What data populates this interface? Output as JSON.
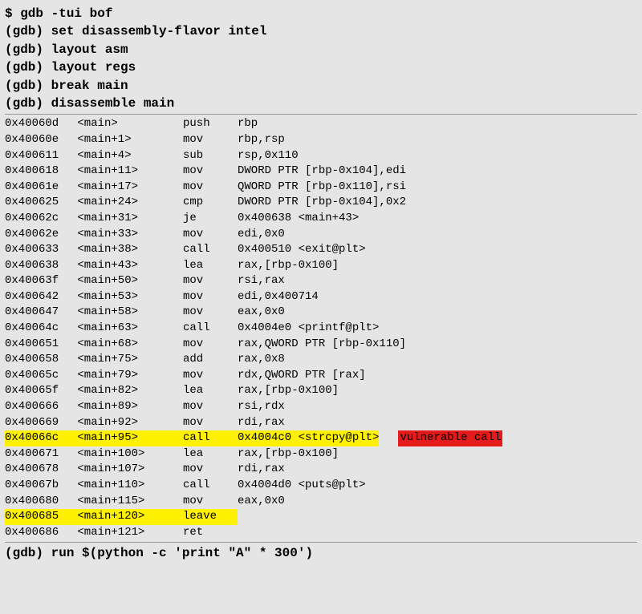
{
  "setup_lines": [
    "$ gdb -tui bof",
    "(gdb) set disassembly-flavor intel",
    "(gdb) layout asm",
    "(gdb) layout regs",
    "(gdb) break main",
    "(gdb) disassemble main"
  ],
  "asm": [
    {
      "addr": "0x40060d",
      "sym": "<main>",
      "op": "push",
      "ops": "rbp"
    },
    {
      "addr": "0x40060e",
      "sym": "<main+1>",
      "op": "mov",
      "ops": "rbp,rsp"
    },
    {
      "addr": "0x400611",
      "sym": "<main+4>",
      "op": "sub",
      "ops": "rsp,0x110"
    },
    {
      "addr": "0x400618",
      "sym": "<main+11>",
      "op": "mov",
      "ops": "DWORD PTR [rbp-0x104],edi"
    },
    {
      "addr": "0x40061e",
      "sym": "<main+17>",
      "op": "mov",
      "ops": "QWORD PTR [rbp-0x110],rsi"
    },
    {
      "addr": "0x400625",
      "sym": "<main+24>",
      "op": "cmp",
      "ops": "DWORD PTR [rbp-0x104],0x2"
    },
    {
      "addr": "0x40062c",
      "sym": "<main+31>",
      "op": "je",
      "ops": "0x400638 <main+43>"
    },
    {
      "addr": "0x40062e",
      "sym": "<main+33>",
      "op": "mov",
      "ops": "edi,0x0"
    },
    {
      "addr": "0x400633",
      "sym": "<main+38>",
      "op": "call",
      "ops": "0x400510 <exit@plt>"
    },
    {
      "addr": "0x400638",
      "sym": "<main+43>",
      "op": "lea",
      "ops": "rax,[rbp-0x100]"
    },
    {
      "addr": "0x40063f",
      "sym": "<main+50>",
      "op": "mov",
      "ops": "rsi,rax"
    },
    {
      "addr": "0x400642",
      "sym": "<main+53>",
      "op": "mov",
      "ops": "edi,0x400714"
    },
    {
      "addr": "0x400647",
      "sym": "<main+58>",
      "op": "mov",
      "ops": "eax,0x0"
    },
    {
      "addr": "0x40064c",
      "sym": "<main+63>",
      "op": "call",
      "ops": "0x4004e0 <printf@plt>"
    },
    {
      "addr": "0x400651",
      "sym": "<main+68>",
      "op": "mov",
      "ops": "rax,QWORD PTR [rbp-0x110]"
    },
    {
      "addr": "0x400658",
      "sym": "<main+75>",
      "op": "add",
      "ops": "rax,0x8"
    },
    {
      "addr": "0x40065c",
      "sym": "<main+79>",
      "op": "mov",
      "ops": "rdx,QWORD PTR [rax]"
    },
    {
      "addr": "0x40065f",
      "sym": "<main+82>",
      "op": "lea",
      "ops": "rax,[rbp-0x100]"
    },
    {
      "addr": "0x400666",
      "sym": "<main+89>",
      "op": "mov",
      "ops": "rsi,rdx"
    },
    {
      "addr": "0x400669",
      "sym": "<main+92>",
      "op": "mov",
      "ops": "rdi,rax"
    },
    {
      "addr": "0x40066c",
      "sym": "<main+95>",
      "op": "call",
      "ops": "0x4004c0 <strcpy@plt>",
      "hl": "full",
      "annot": "vulnerable call"
    },
    {
      "addr": "0x400671",
      "sym": "<main+100>",
      "op": "lea",
      "ops": "rax,[rbp-0x100]"
    },
    {
      "addr": "0x400678",
      "sym": "<main+107>",
      "op": "mov",
      "ops": "rdi,rax"
    },
    {
      "addr": "0x40067b",
      "sym": "<main+110>",
      "op": "call",
      "ops": "0x4004d0 <puts@plt>"
    },
    {
      "addr": "0x400680",
      "sym": "<main+115>",
      "op": "mov",
      "ops": "eax,0x0"
    },
    {
      "addr": "0x400685",
      "sym": "<main+120>",
      "op": "leave",
      "ops": "",
      "hl": "leave"
    },
    {
      "addr": "0x400686",
      "sym": "<main+121>",
      "op": "ret",
      "ops": ""
    }
  ],
  "run_line": "(gdb) run $(python -c 'print \"A\" * 300')"
}
